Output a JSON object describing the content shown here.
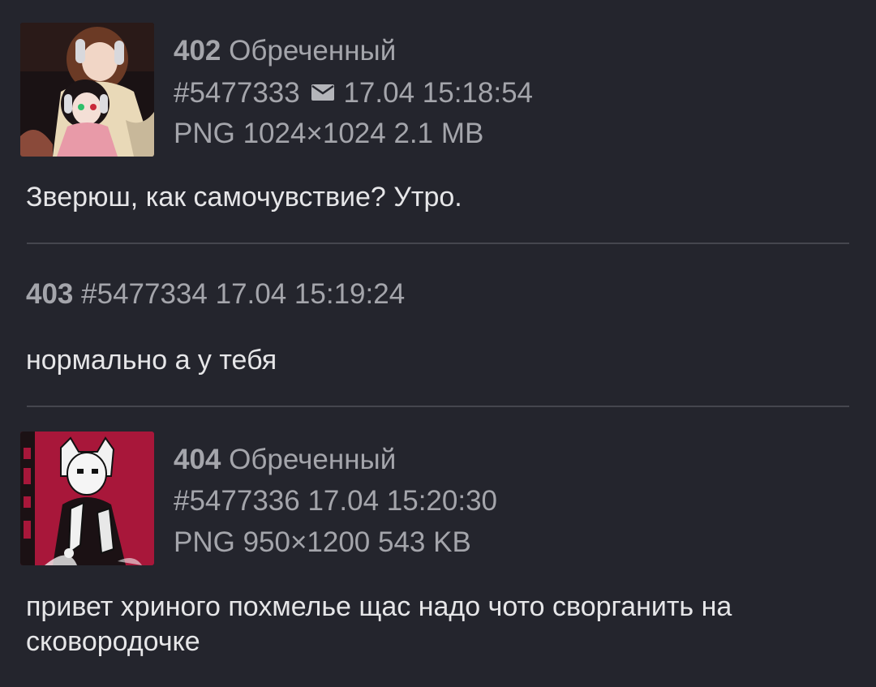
{
  "posts": [
    {
      "num": "402",
      "name": "Обреченный",
      "id": "#5477333",
      "has_email": true,
      "date": "17.04 15:18:54",
      "file_info": "PNG 1024×1024 2.1 MB",
      "thumb_icon": "anime-image-thumbnail",
      "text": "Зверюш, как самочувствие? Утро."
    },
    {
      "num": "403",
      "id": "#5477334",
      "date": "17.04 15:19:24",
      "text": "нормально а у тебя"
    },
    {
      "num": "404",
      "name": "Обреченный",
      "id": "#5477336",
      "date": "17.04 15:20:30",
      "file_info": "PNG 950×1200 543 KB",
      "thumb_icon": "anime-image-thumbnail",
      "text": "привет хриного похмелье щас надо чото сворганить на сковородочке"
    }
  ],
  "colors": {
    "background": "#24252d",
    "meta_text": "#a4a5ab",
    "body_text": "#e6e6e8",
    "divider": "#45464e",
    "thumb2_accent": "#a8173a"
  }
}
